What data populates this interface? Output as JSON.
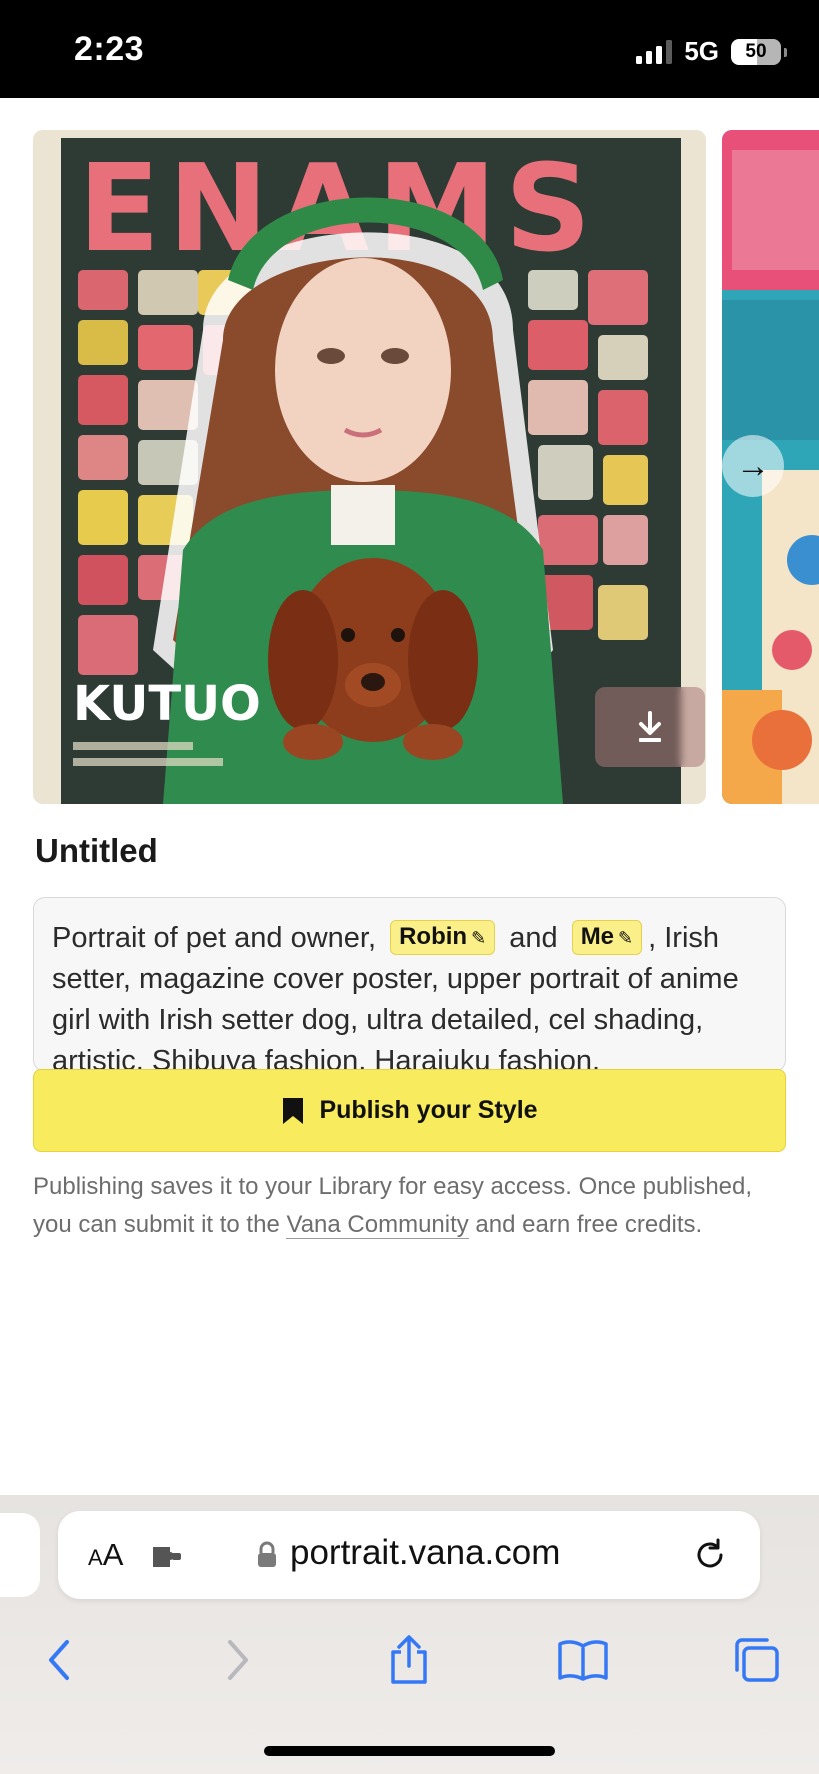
{
  "status_bar": {
    "time": "2:23",
    "network": "5G",
    "battery": "50"
  },
  "carousel": {
    "main_image": {
      "cover_text_top": "ENAMS",
      "cover_text_bottom": "KUTUO"
    },
    "next_arrow": "→",
    "download": "download"
  },
  "style": {
    "title": "Untitled",
    "prompt": {
      "prefix": "Portrait of pet and owner,",
      "chip1": "Robin",
      "middle": "and",
      "chip2": "Me",
      "rest": ", Irish setter, magazine cover poster, upper portrait of anime girl with Irish setter dog, ultra detailed, cel shading, artistic, Shibuya fashion, Harajuku fashion."
    },
    "publish_label": "Publish your Style",
    "help_before": "Publishing saves it to your Library for easy access. Once published, you can submit it to the ",
    "help_link": "Vana Community",
    "help_after": " and earn free credits."
  },
  "browser": {
    "aa_label_small": "A",
    "aa_label_large": "A",
    "url": "portrait.vana.com"
  },
  "colors": {
    "accent": "#f8ec5e",
    "chip": "#fbef8a",
    "ios_blue": "#3478f6"
  }
}
